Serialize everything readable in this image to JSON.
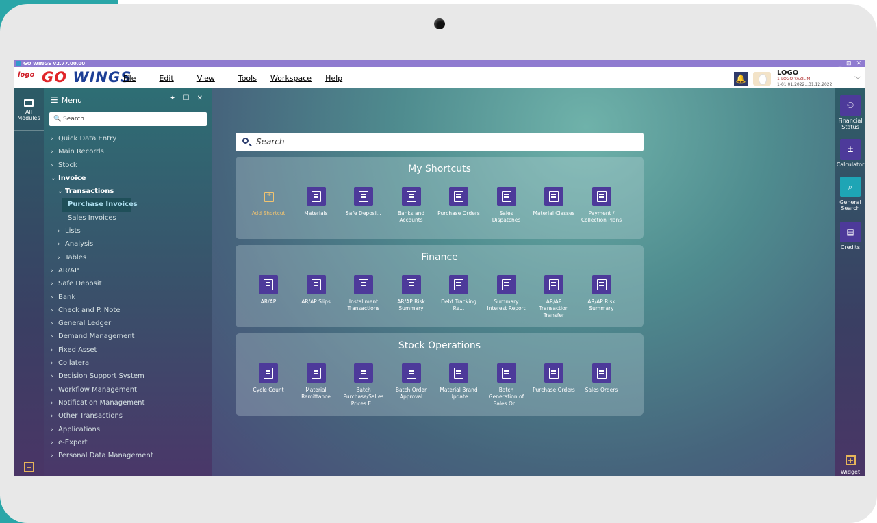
{
  "app": {
    "window_title": "GO WINGS v2.77.00.00",
    "window_controls": "_ ⊡ ✕",
    "logo_small": "logo",
    "logo_big_a": "GO",
    "logo_big_b": "WINGS"
  },
  "menubar": {
    "items": [
      "File",
      "Edit",
      "View",
      "Tools",
      "Workspace",
      "Help"
    ]
  },
  "user": {
    "company": "LOGO",
    "firm": "1-LOGO YAZILIM",
    "period": "1-01.01.2022...31.12.2022"
  },
  "left_strip": {
    "all_modules": "All Modules"
  },
  "menu_panel": {
    "title": "Menu",
    "controls": "✦ ☐ ✕",
    "search_placeholder": "Search",
    "items": [
      "Quick Data Entry",
      "Main Records",
      "Stock",
      "Invoice",
      "Transactions",
      "Purchase Invoices",
      "Sales Invoices",
      "Lists",
      "Analysis",
      "Tables",
      "AR/AP",
      "Safe Deposit",
      "Bank",
      "Check and P. Note",
      "General Ledger",
      "Demand Management",
      "Fixed Asset",
      "Collateral",
      "Decision Support System",
      "Workflow Management",
      "Notification Management",
      "Other Transactions",
      "Applications",
      "e-Export",
      "Personal Data Management"
    ]
  },
  "main_search": {
    "placeholder": "Search"
  },
  "sections": {
    "shortcuts": {
      "title": "My Shortcuts",
      "tiles": [
        "Add Shortcut",
        "Materials",
        "Safe Deposi...",
        "Banks and Accounts",
        "Purchase Orders",
        "Sales Dispatches",
        "Material Classes",
        "Payment / Collection Plans"
      ]
    },
    "finance": {
      "title": "Finance",
      "tiles": [
        "AR/AP",
        "AR/AP Slips",
        "Installment Transactions",
        "AR/AP Risk Summary",
        "Debt Tracking Re...",
        "Summary Interest Report",
        "AR/AP Transaction Transfer",
        "AR/AP Risk Summary"
      ]
    },
    "stock": {
      "title": "Stock Operations",
      "tiles": [
        "Cycle Count",
        "Material Remittance",
        "Batch Purchase/Sal es Prices E...",
        "Batch Order Approval",
        "Material Brand Update",
        "Batch Generation of Sales Or...",
        "Purchase Orders",
        "Sales Orders"
      ]
    }
  },
  "right_strip": {
    "items": [
      "Financial Status",
      "Calculator",
      "General Search",
      "Credits"
    ],
    "widget": "Widget"
  }
}
